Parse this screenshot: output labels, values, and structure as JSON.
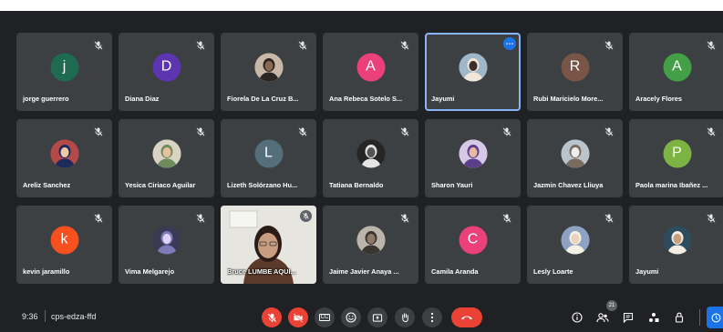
{
  "meeting": {
    "time": "9:36",
    "code": "cps-edza-ffd",
    "participant_count": "21"
  },
  "colors": {
    "tile_bg": "#3c4043",
    "screen_bg": "#202124",
    "red": "#ea4335",
    "active_outline": "#8ab4f8",
    "blue": "#1a73e8"
  },
  "participants": [
    {
      "name": "jorge guerrero",
      "initial": "j",
      "color": "#1e6b52"
    },
    {
      "name": "Diana Diaz",
      "initial": "D",
      "color": "#5e35b1"
    },
    {
      "name": "Fiorela De La Cruz B...",
      "photo": true
    },
    {
      "name": "Ana Rebeca Sotelo S...",
      "initial": "A",
      "color": "#ec407a"
    },
    {
      "name": "Jayumi",
      "photo": true,
      "active": true
    },
    {
      "name": "Rubi Maricielo More...",
      "initial": "R",
      "color": "#795548"
    },
    {
      "name": "Aracely Flores",
      "initial": "A",
      "color": "#43a047"
    },
    {
      "name": "Areliz Sanchez",
      "photo": true
    },
    {
      "name": "Yesica Ciriaco Aguilar",
      "photo": true
    },
    {
      "name": "Lizeth Solórzano Hu...",
      "initial": "L",
      "color": "#546e7a"
    },
    {
      "name": "Tatiana Bernaldo",
      "photo": true
    },
    {
      "name": "Sharon Yauri",
      "photo": true
    },
    {
      "name": "Jazmin Chavez Lliuya",
      "photo": true
    },
    {
      "name": "Paola marina Ibañez ...",
      "initial": "P",
      "color": "#7cb342"
    },
    {
      "name": "kevin jaramillo",
      "initial": "k",
      "color": "#f4511e"
    },
    {
      "name": "Vima Melgarejo",
      "photo": true
    },
    {
      "name": "Bruce LUMBE AQUI...",
      "video": true
    },
    {
      "name": "Jaime Javier Anaya ...",
      "photo": true
    },
    {
      "name": "Camila Aranda",
      "initial": "C",
      "color": "#ec407a"
    },
    {
      "name": "Lesly Loarte",
      "photo": true
    },
    {
      "name": "Jayumi",
      "photo": true
    }
  ],
  "controls": {
    "mic": "microphone-off-icon",
    "camera": "camera-off-icon",
    "captions_label": "CC",
    "reactions": "emoji-icon",
    "present": "present-screen-icon",
    "raise_hand": "raise-hand-icon",
    "more": "more-options-icon",
    "leave": "hang-up-icon"
  },
  "right_panel": {
    "info": "info-icon",
    "people": "people-icon",
    "chat": "chat-icon",
    "activities": "activities-icon",
    "host_controls": "host-controls-icon",
    "active": "clock-activity-icon"
  }
}
